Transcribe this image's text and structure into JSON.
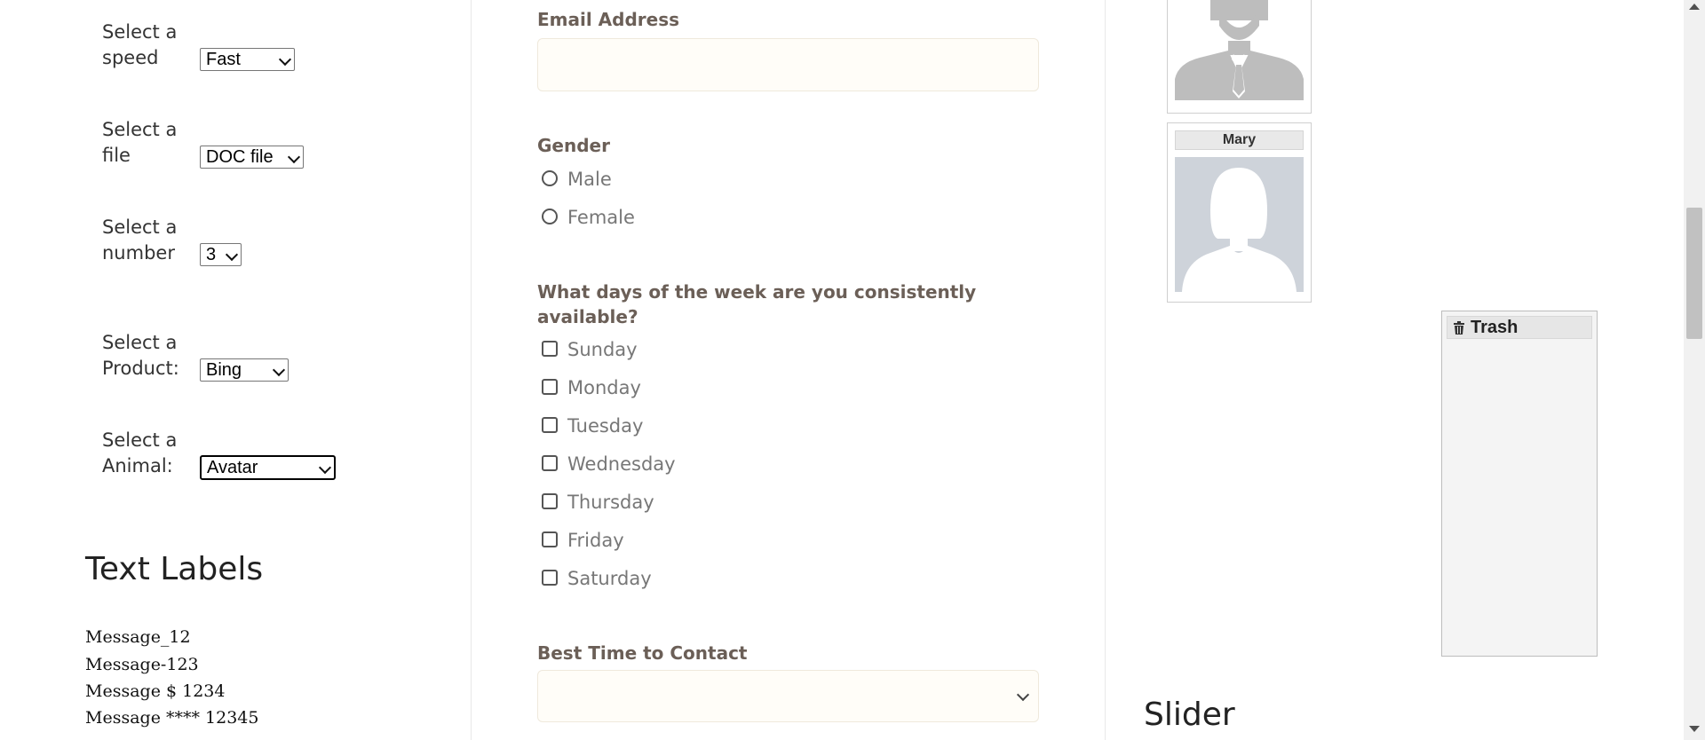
{
  "selects": [
    {
      "label": "Select a speed",
      "value": "Fast"
    },
    {
      "label": "Select a file",
      "value": "DOC file"
    },
    {
      "label": "Select a number",
      "value": "3"
    },
    {
      "label": "Select a Product:",
      "value": "Bing"
    },
    {
      "label": "Select a Animal:",
      "value": "Avatar"
    }
  ],
  "text_labels": {
    "heading": "Text Labels",
    "messages": [
      "Message_12",
      "Message-123",
      "Message $ 1234",
      "Message **** 12345"
    ]
  },
  "form": {
    "email_label": "Email Address",
    "email_value": "",
    "gender_label": "Gender",
    "gender_options": [
      "Male",
      "Female"
    ],
    "days_label": "What days of the week are you consistently available?",
    "days": [
      "Sunday",
      "Monday",
      "Tuesday",
      "Wednesday",
      "Thursday",
      "Friday",
      "Saturday"
    ],
    "best_time_label": "Best Time to Contact",
    "best_time_value": ""
  },
  "gallery": {
    "cards": [
      {
        "name": ""
      },
      {
        "name": "Mary"
      }
    ],
    "trash_label": "Trash"
  },
  "slider": {
    "heading": "Slider"
  },
  "icons": {
    "trash": "trash-icon",
    "select_arrow": "chevron-down-icon"
  },
  "colors": {
    "label_brown": "#6b5f57",
    "input_bg": "#fffdf8",
    "avatar_bg": "#ced3da"
  }
}
